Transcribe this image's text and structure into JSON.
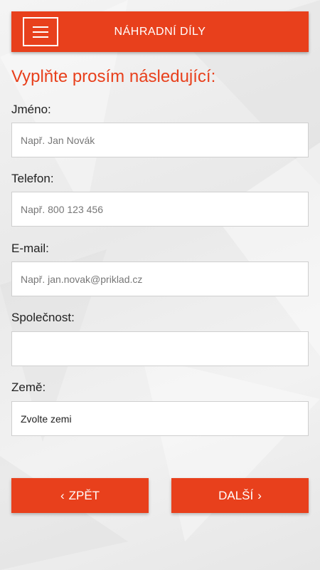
{
  "header": {
    "title": "NÁHRADNÍ DÍLY"
  },
  "form": {
    "heading": "Vyplňte prosím následující:",
    "fields": [
      {
        "label": "Jméno:",
        "placeholder": "Např. Jan Novák",
        "value": ""
      },
      {
        "label": "Telefon:",
        "placeholder": "Např. 800 123 456",
        "value": ""
      },
      {
        "label": "E-mail:",
        "placeholder": "Např. jan.novak@priklad.cz",
        "value": ""
      },
      {
        "label": "Společnost:",
        "placeholder": "",
        "value": ""
      }
    ],
    "country": {
      "label": "Země:",
      "selected": "Zvolte zemi"
    }
  },
  "buttons": {
    "back_label": "ZPĚT",
    "back_icon": "chevron-left-icon",
    "next_label": "DALŠÍ",
    "next_icon": "chevron-right-icon"
  },
  "colors": {
    "accent": "#e8401c",
    "background": "#eeeeee"
  }
}
